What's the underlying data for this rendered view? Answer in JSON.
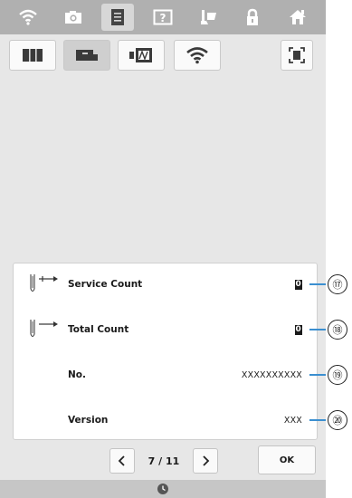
{
  "topbar": {
    "icons": [
      "wifi-icon",
      "camera-icon",
      "document-icon",
      "help-icon",
      "sewing-icon",
      "lock-icon",
      "home-icon"
    ]
  },
  "subtabs": {
    "icons": [
      "book-icon",
      "machine-icon",
      "embroidery-frame-icon",
      "wifi-icon",
      "screen-capture-icon"
    ]
  },
  "panel": {
    "rows": [
      {
        "label": "Service Count",
        "value": "0"
      },
      {
        "label": "Total Count",
        "value": "0"
      },
      {
        "label": "No.",
        "value": "XXXXXXXXXX"
      },
      {
        "label": "Version",
        "value": "XXX"
      }
    ]
  },
  "pager": {
    "text": "7 / 11"
  },
  "ok_label": "OK",
  "callouts": [
    "⑰",
    "⑱",
    "⑲",
    "⑳"
  ],
  "colors": {
    "topbar": "#b0b0b0",
    "screen": "#e7e7e7",
    "callout_line": "#3b8fd0"
  }
}
